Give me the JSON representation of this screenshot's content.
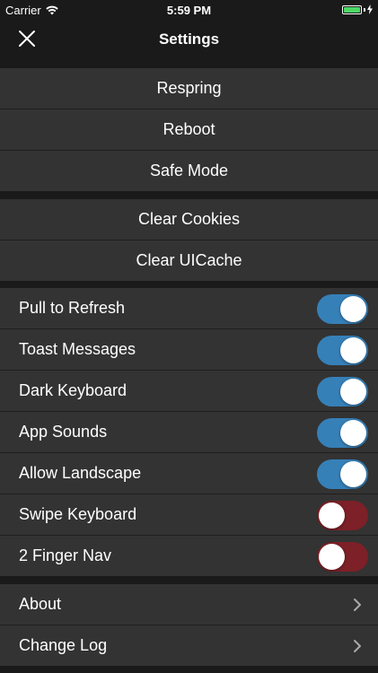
{
  "status_bar": {
    "carrier": "Carrier",
    "time": "5:59 PM",
    "wifi_icon": "wifi-icon",
    "battery_icon": "battery-icon",
    "battery_level": 1.0,
    "battery_color": "#4cd964"
  },
  "nav": {
    "title": "Settings",
    "close_icon": "close-icon"
  },
  "actions_1": [
    {
      "label": "Respring"
    },
    {
      "label": "Reboot"
    },
    {
      "label": "Safe Mode"
    }
  ],
  "actions_2": [
    {
      "label": "Clear Cookies"
    },
    {
      "label": "Clear UICache"
    }
  ],
  "toggles": [
    {
      "label": "Pull to Refresh",
      "on": true
    },
    {
      "label": "Toast Messages",
      "on": true
    },
    {
      "label": "Dark Keyboard",
      "on": true
    },
    {
      "label": "App Sounds",
      "on": true
    },
    {
      "label": "Allow Landscape",
      "on": true
    },
    {
      "label": "Swipe Keyboard",
      "on": false
    },
    {
      "label": "2 Finger Nav",
      "on": false
    }
  ],
  "links": [
    {
      "label": "About",
      "icon": "chevron-right-icon"
    },
    {
      "label": "Change Log",
      "icon": "chevron-right-icon"
    }
  ],
  "colors": {
    "toggle_on": "#3680b8",
    "toggle_off": "#7d2027",
    "row_background": "#333333",
    "background": "#1a1a1a"
  }
}
